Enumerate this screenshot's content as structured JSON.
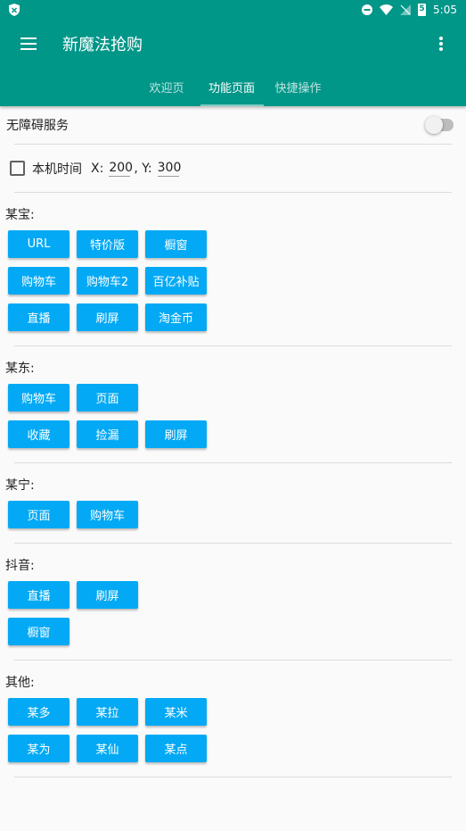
{
  "status_bar": {
    "time": "5:05",
    "battery_level": "5"
  },
  "app_bar": {
    "title": "新魔法抢购"
  },
  "tabs": [
    {
      "label": "欢迎页",
      "active": false
    },
    {
      "label": "功能页面",
      "active": true
    },
    {
      "label": "快捷操作",
      "active": false
    }
  ],
  "accessibility": {
    "label": "无障碍服务",
    "enabled": false
  },
  "local_time": {
    "label": "本机时间",
    "x_label": "X:",
    "x_value": "200",
    "y_label": ", Y:",
    "y_value": "300",
    "checked": false
  },
  "sections": [
    {
      "title": "某宝:",
      "rows": [
        [
          "URL",
          "特价版",
          "橱窗"
        ],
        [
          "购物车",
          "购物车2",
          "百亿补贴"
        ],
        [
          "直播",
          "刷屏",
          "淘金币"
        ]
      ]
    },
    {
      "title": "某东:",
      "rows": [
        [
          "购物车",
          "页面"
        ],
        [
          "收藏",
          "捡漏",
          "刷屏"
        ]
      ]
    },
    {
      "title": "某宁:",
      "rows": [
        [
          "页面",
          "购物车"
        ]
      ]
    },
    {
      "title": "抖音:",
      "rows": [
        [
          "直播",
          "刷屏"
        ],
        [
          "橱窗"
        ]
      ]
    },
    {
      "title": "其他:",
      "rows": [
        [
          "某多",
          "某拉",
          "某米"
        ],
        [
          "某为",
          "某仙",
          "某点"
        ]
      ]
    }
  ],
  "colors": {
    "primary": "#009688",
    "button": "#03a9f4"
  }
}
